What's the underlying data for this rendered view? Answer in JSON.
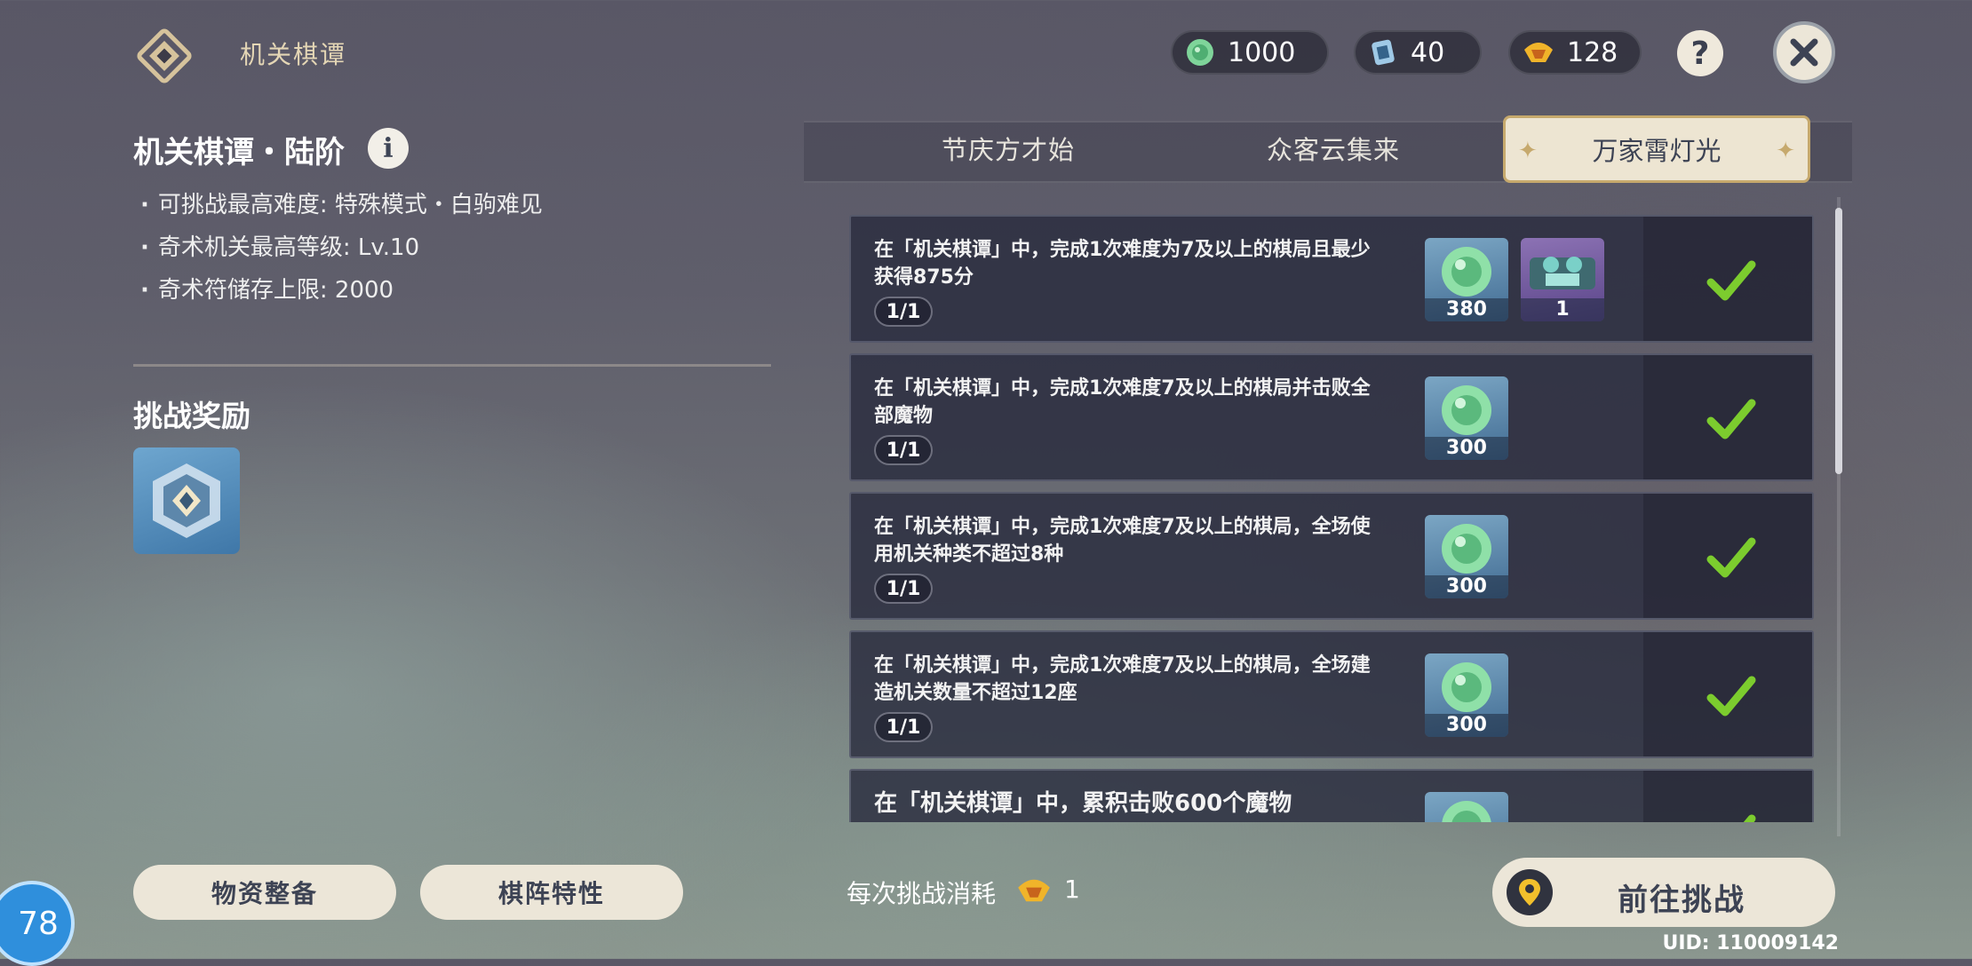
{
  "header": {
    "title": "机关棋谭",
    "currencies": [
      {
        "icon": "green-coin-icon",
        "value": "1000"
      },
      {
        "icon": "blue-rune-icon",
        "value": "40"
      },
      {
        "icon": "gold-lantern-icon",
        "value": "128"
      }
    ],
    "help_label": "?"
  },
  "stage": {
    "title": "机关棋谭・陆阶",
    "info_label": "i",
    "bullets": [
      "可挑战最高难度: 特殊模式・白驹难见",
      "奇术机关最高等级: Lv.10",
      "奇术符储存上限: 2000"
    ]
  },
  "rewards": {
    "title": "挑战奖励"
  },
  "tabs": [
    {
      "label": "节庆方才始",
      "active": false
    },
    {
      "label": "众客云集来",
      "active": false
    },
    {
      "label": "万家霄灯光",
      "active": true
    }
  ],
  "tasks": [
    {
      "desc": "在「机关棋谭」中，完成1次难度为7及以上的棋局且最少获得875分",
      "progress": "1/1",
      "rewards": [
        {
          "icon": "green-coin-icon",
          "count": "380"
        },
        {
          "icon": "ornament-icon",
          "count": "1"
        }
      ],
      "done": true
    },
    {
      "desc": "在「机关棋谭」中，完成1次难度7及以上的棋局并击败全部魔物",
      "progress": "1/1",
      "rewards": [
        {
          "icon": "green-coin-icon",
          "count": "300"
        }
      ],
      "done": true
    },
    {
      "desc": "在「机关棋谭」中，完成1次难度7及以上的棋局，全场使用机关种类不超过8种",
      "progress": "1/1",
      "rewards": [
        {
          "icon": "green-coin-icon",
          "count": "300"
        }
      ],
      "done": true
    },
    {
      "desc": "在「机关棋谭」中，完成1次难度7及以上的棋局，全场建造机关数量不超过12座",
      "progress": "1/1",
      "rewards": [
        {
          "icon": "green-coin-icon",
          "count": "300"
        }
      ],
      "done": true
    },
    {
      "desc": "在「机关棋谭」中，累积击败600个魔物",
      "progress": "",
      "rewards": [
        {
          "icon": "green-coin-icon",
          "count": ""
        }
      ],
      "done": true
    }
  ],
  "footer": {
    "btn_supplies": "物资整备",
    "btn_features": "棋阵特性",
    "cost_label": "每次挑战消耗",
    "cost_value": "1",
    "go_label": "前往挑战",
    "uid": "UID: 110009142",
    "level": "78"
  },
  "colors": {
    "accent_gold": "#c6a96d",
    "check_green": "#7ccc2e",
    "cream": "#ece6d8"
  }
}
